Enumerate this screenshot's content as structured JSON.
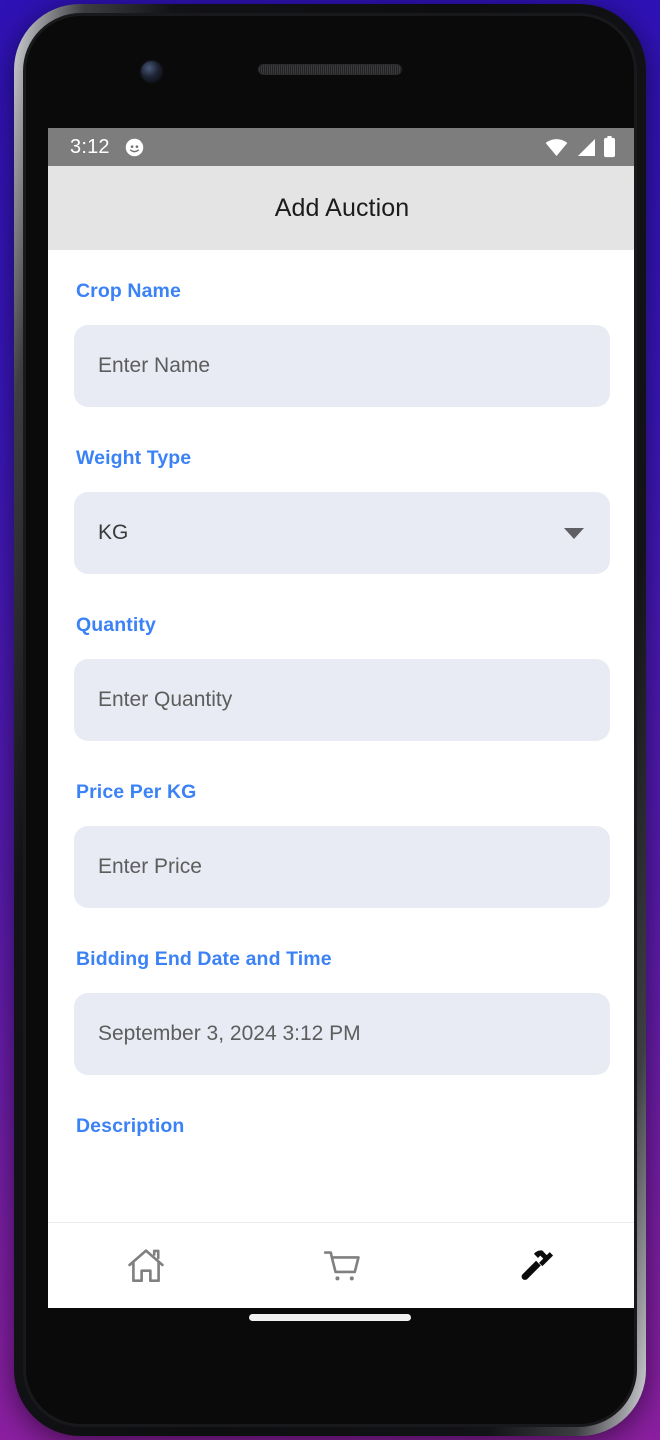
{
  "status_bar": {
    "time": "3:12",
    "notification_icon": "cat-face-icon",
    "wifi_icon": "wifi-icon",
    "signal_icon": "cellular-signal-icon",
    "battery_icon": "battery-full-icon",
    "background_color": "#7d7d7d"
  },
  "app_bar": {
    "title": "Add Auction",
    "background_color": "#e4e4e4"
  },
  "theme": {
    "label_color": "#3b82f6",
    "field_background": "#e8ebf3",
    "screen_background": "#ffffff",
    "device_backdrop": "#3a17b8"
  },
  "form": {
    "fields": [
      {
        "label": "Crop Name",
        "type": "text",
        "placeholder": "Enter Name",
        "value": ""
      },
      {
        "label": "Weight Type",
        "type": "select",
        "value": "KG",
        "options": [
          "KG"
        ],
        "caret_icon": "chevron-down-icon"
      },
      {
        "label": "Quantity",
        "type": "text",
        "placeholder": "Enter Quantity",
        "value": ""
      },
      {
        "label": "Price Per KG",
        "type": "text",
        "placeholder": "Enter Price",
        "value": ""
      },
      {
        "label": "Bidding End Date and Time",
        "type": "datetime",
        "value": "September 3, 2024 3:12 PM"
      },
      {
        "label": "Description",
        "type": "textarea",
        "placeholder": "",
        "value": ""
      }
    ]
  },
  "bottom_nav": {
    "items": [
      {
        "icon": "home-icon",
        "active": false
      },
      {
        "icon": "shopping-cart-icon",
        "active": false
      },
      {
        "icon": "hammer-icon",
        "active": true
      }
    ]
  }
}
